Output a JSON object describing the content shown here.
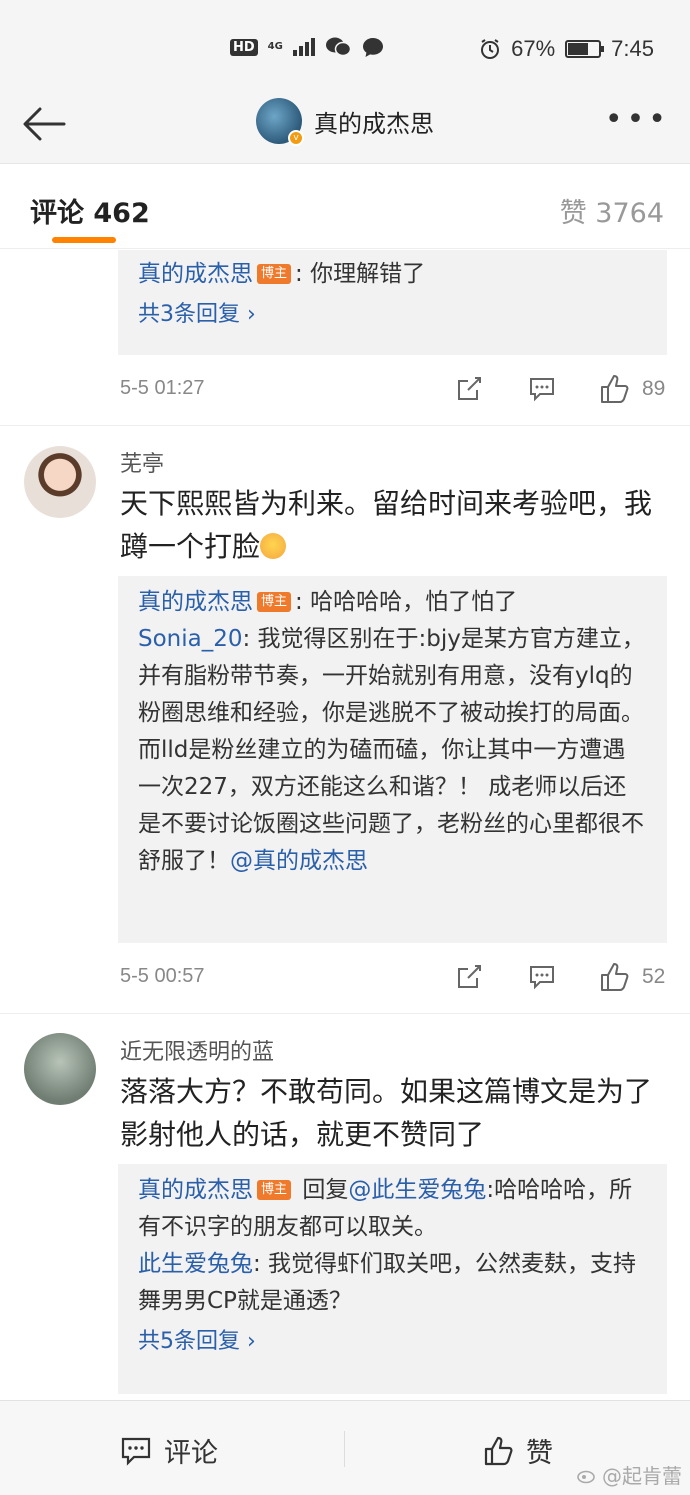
{
  "status_bar": {
    "hd": "HD",
    "network": "4G",
    "battery": "67%",
    "time": "7:45",
    "battery_level": 0.67
  },
  "nav": {
    "title": "真的成杰思"
  },
  "tabs": {
    "comments_label": "评论 462",
    "likes_label": "赞 3764"
  },
  "comment0": {
    "replies": [
      {
        "name": "真的成杰思",
        "badge": "博主",
        "text": ": 你理解错了"
      }
    ],
    "more_replies": "共3条回复 ›",
    "time": "5-5 01:27",
    "likes": "89"
  },
  "comment1": {
    "user": "芜亭",
    "text": "天下熙熙皆为利来。留给时间来考验吧，我蹲一个打脸",
    "replies": [
      {
        "name": "真的成杰思",
        "badge": "博主",
        "text": ": 哈哈哈哈，怕了怕了"
      },
      {
        "name": "Sonia_20",
        "text": ": 我觉得区别在于:bjy是某方官方建立，并有脂粉带节奏，一开始就别有用意，没有ylq的粉圈思维和经验，你是逃脱不了被动挨打的局面。而lld是粉丝建立的为磕而磕，你让其中一方遭遇一次227，双方还能这么和谐？！ 成老师以后还是不要讨论饭圈这些问题了，老粉丝的心里都很不舒服了！",
        "mention": "@真的成杰思"
      }
    ],
    "time": "5-5 00:57",
    "likes": "52"
  },
  "comment2": {
    "user": "近无限透明的蓝",
    "text": "落落大方？不敢苟同。如果这篇博文是为了影射他人的话，就更不赞同了",
    "replies": [
      {
        "name": "真的成杰思",
        "badge": "博主",
        "prefix": " 回复",
        "mention": "@此生爱兔兔",
        "text": ":哈哈哈哈，所有不识字的朋友都可以取关。"
      },
      {
        "name": "此生爱兔兔",
        "text": ": 我觉得虾们取关吧，公然麦麸，支持舞男男CP就是通透？"
      }
    ],
    "more_replies": "共5条回复 ›"
  },
  "bottom_bar": {
    "comment_label": "评论",
    "like_label": "赞"
  },
  "watermark": "@起肯蕾"
}
